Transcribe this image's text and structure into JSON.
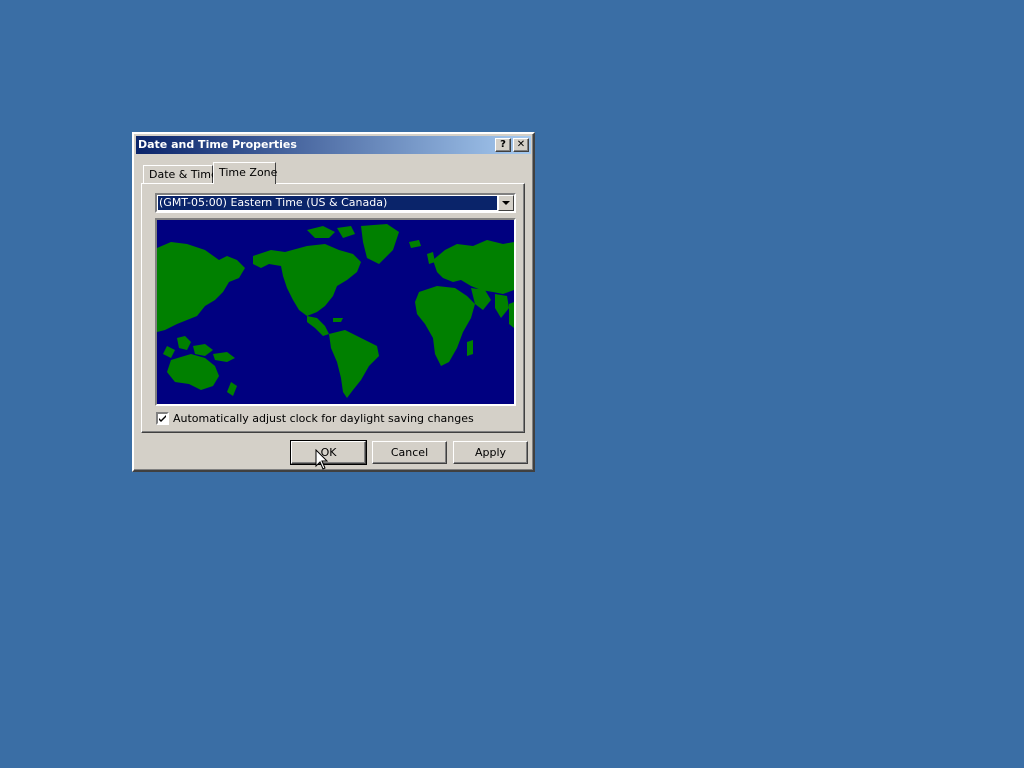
{
  "window": {
    "title": "Date and Time Properties",
    "help_icon": "help-icon",
    "close_icon": "close-icon"
  },
  "tabs": [
    {
      "label": "Date & Time",
      "selected": false
    },
    {
      "label": "Time Zone",
      "selected": true
    }
  ],
  "timezone": {
    "selected": "(GMT-05:00) Eastern Time (US & Canada)"
  },
  "map": {
    "ocean_color": "#000080",
    "land_color": "#008000",
    "icon": "world-map"
  },
  "daylight": {
    "label": "Automatically adjust clock for daylight saving changes",
    "checked": true
  },
  "buttons": {
    "ok": "OK",
    "cancel": "Cancel",
    "apply": "Apply"
  },
  "colors": {
    "desktop": "#3a6ea5",
    "titlebar_start": "#0a246a",
    "titlebar_end": "#a6caf0",
    "face": "#d4d0c8"
  }
}
